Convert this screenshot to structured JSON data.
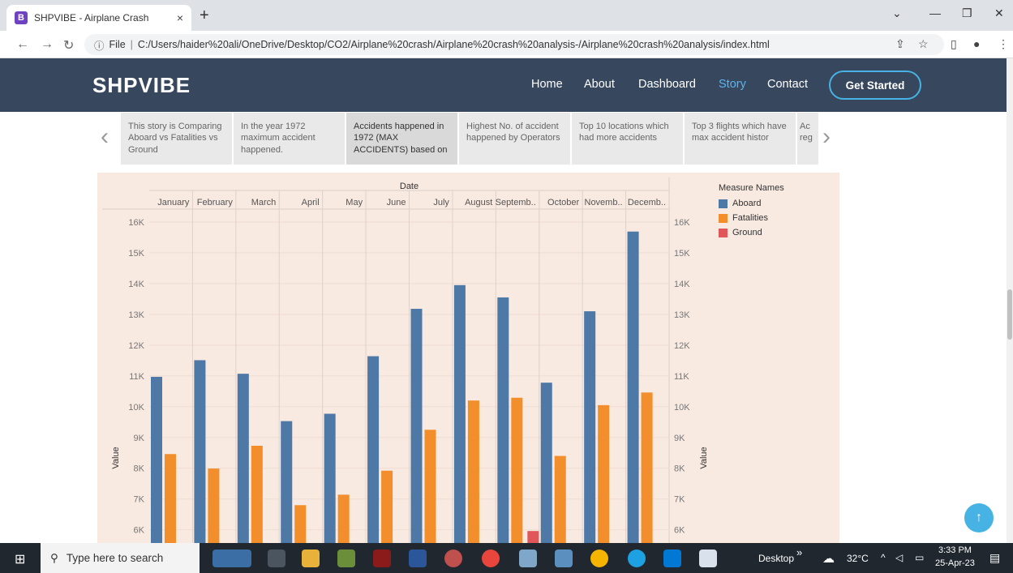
{
  "browser": {
    "tab_favicon": "B",
    "tab_title": "SHPVIBE - Airplane Crash",
    "new_tab": "+",
    "close": "×",
    "url_prefix": "File",
    "url": "C:/Users/haider%20ali/OneDrive/Desktop/CO2/Airplane%20crash/Airplane%20crash%20analysis-/Airplane%20crash%20analysis/index.html"
  },
  "site": {
    "logo": "SHPVIBE",
    "nav": [
      "Home",
      "About",
      "Dashboard",
      "Story",
      "Contact"
    ],
    "active_nav": "Story",
    "cta": "Get Started"
  },
  "story": {
    "points": [
      "This story is Comparing Aboard vs Fatalities vs Ground",
      "In the year 1972 maximum accident happened.",
      "Accidents happened in 1972 (MAX ACCIDENTS) based on",
      "Highest No. of accident happened by Operators",
      "Top 10 locations which had more accidents",
      "Top 3 flights which have max accident histor",
      "Ac reg"
    ],
    "active_index": 2
  },
  "chart_data": {
    "type": "bar",
    "title": "Date",
    "ylabel": "Value",
    "categories": [
      "January",
      "February",
      "March",
      "April",
      "May",
      "June",
      "July",
      "August",
      "Septemb..",
      "October",
      "Novemb..",
      "Decemb.."
    ],
    "series": [
      {
        "name": "Aboard",
        "color": "#4e79a7",
        "values": [
          10970,
          11510,
          11070,
          9530,
          9770,
          11640,
          13180,
          13950,
          13550,
          10780,
          13100,
          15690
        ]
      },
      {
        "name": "Fatalities",
        "color": "#f28e2b",
        "values": [
          8460,
          7990,
          8730,
          6800,
          7140,
          7920,
          9250,
          10200,
          10290,
          8400,
          10050,
          10460
        ]
      },
      {
        "name": "Ground",
        "color": "#e15759",
        "values": [
          null,
          null,
          null,
          null,
          null,
          null,
          null,
          null,
          5960,
          null,
          null,
          null
        ]
      }
    ],
    "yticks": [
      "6K",
      "7K",
      "8K",
      "9K",
      "10K",
      "11K",
      "12K",
      "13K",
      "14K",
      "15K",
      "16K"
    ],
    "ylim": [
      5570,
      16420
    ],
    "legend_title": "Measure Names",
    "legend": [
      "Aboard",
      "Fatalities",
      "Ground"
    ],
    "legend_position": "right",
    "grid": true
  },
  "taskbar": {
    "search_placeholder": "Type here to search",
    "desktop_label": "Desktop",
    "chevron": "»",
    "temperature": "32°C",
    "time": "3:33 PM",
    "date": "25-Apr-23"
  }
}
